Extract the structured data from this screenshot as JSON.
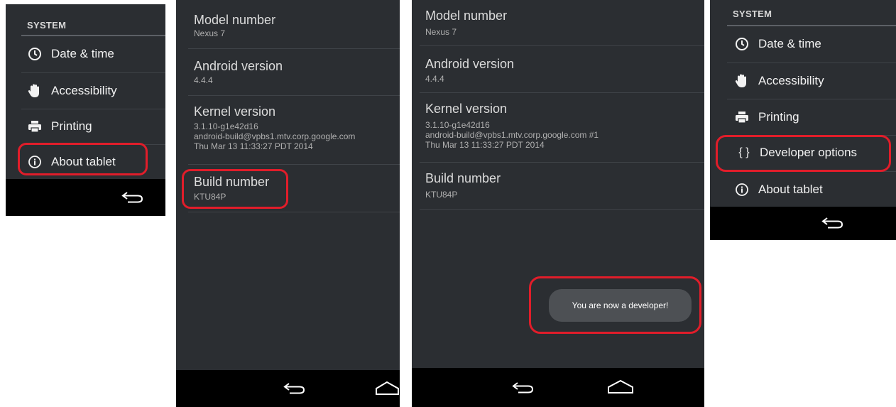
{
  "panel1": {
    "section_header": "SYSTEM",
    "items": [
      {
        "label": "Date & time",
        "icon": "clock-icon"
      },
      {
        "label": "Accessibility",
        "icon": "hand-icon"
      },
      {
        "label": "Printing",
        "icon": "printer-icon"
      },
      {
        "label": "About tablet",
        "icon": "info-icon"
      }
    ]
  },
  "panel2": {
    "rows": [
      {
        "title": "Model number",
        "value": "Nexus 7"
      },
      {
        "title": "Android version",
        "value": "4.4.4"
      },
      {
        "title": "Kernel version",
        "value_lines": [
          "3.1.10-g1e42d16",
          "android-build@vpbs1.mtv.corp.google.com",
          "Thu Mar 13 11:33:27 PDT 2014"
        ]
      },
      {
        "title": "Build number",
        "value": "KTU84P"
      }
    ]
  },
  "panel3": {
    "rows": [
      {
        "title": "Model number",
        "value": "Nexus 7"
      },
      {
        "title": "Android version",
        "value": "4.4.4"
      },
      {
        "title": "Kernel version",
        "value_lines": [
          "3.1.10-g1e42d16",
          "android-build@vpbs1.mtv.corp.google.com #1",
          "Thu Mar 13 11:33:27 PDT 2014"
        ]
      },
      {
        "title": "Build number",
        "value": "KTU84P"
      }
    ],
    "toast": "You are now a developer!"
  },
  "panel4": {
    "section_header": "SYSTEM",
    "items": [
      {
        "label": "Date & time",
        "icon": "clock-icon"
      },
      {
        "label": "Accessibility",
        "icon": "hand-icon"
      },
      {
        "label": "Printing",
        "icon": "printer-icon"
      },
      {
        "label": "Developer options",
        "icon": "braces-icon"
      },
      {
        "label": "About tablet",
        "icon": "info-icon"
      }
    ]
  },
  "colors": {
    "panel_bg": "#2b2e32",
    "nav_bg": "#000000",
    "highlight": "#e11d2a",
    "toast_bg": "#4d5054"
  }
}
